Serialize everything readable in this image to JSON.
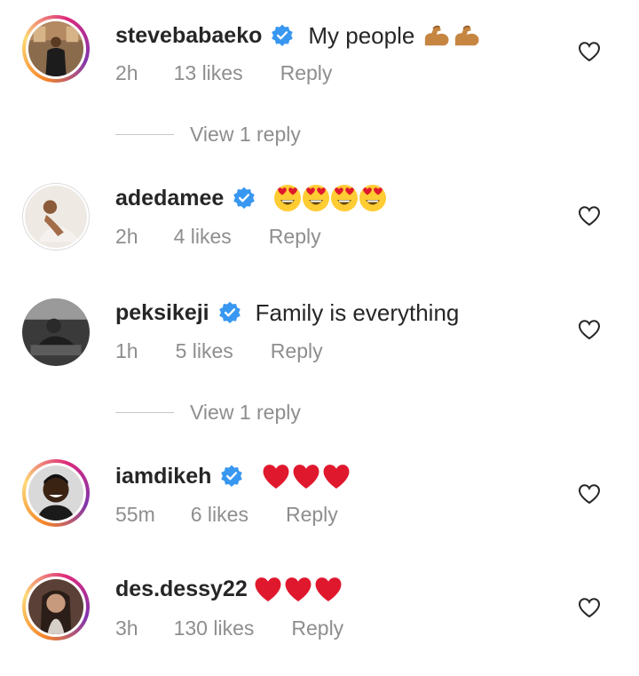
{
  "comments": [
    {
      "username": "stevebabaeko",
      "text": "My people",
      "emoji": "flexed-biceps x2",
      "time": "2h",
      "likes": "13 likes",
      "reply": "Reply",
      "view_replies": "View 1 reply"
    },
    {
      "username": "adedamee",
      "text": "",
      "emoji": "heart-eyes x4",
      "time": "2h",
      "likes": "4 likes",
      "reply": "Reply"
    },
    {
      "username": "peksikeji",
      "text": "Family is everything",
      "time": "1h",
      "likes": "5 likes",
      "reply": "Reply",
      "view_replies": "View 1 reply"
    },
    {
      "username": "iamdikeh",
      "text": "",
      "emoji": "red-heart x3",
      "time": "55m",
      "likes": "6 likes",
      "reply": "Reply"
    },
    {
      "username": "des.dessy22",
      "text": "",
      "emoji": "red-heart x3",
      "time": "3h",
      "likes": "130 likes",
      "reply": "Reply"
    }
  ],
  "colors": {
    "verified": "#3897f0",
    "muted": "#8e8e8e",
    "text": "#262626",
    "heart_emoji": "#e0182e",
    "emoji_face": "#ffcc33"
  },
  "icons": {
    "verified": "verified-badge-icon",
    "like": "heart-outline-icon"
  }
}
